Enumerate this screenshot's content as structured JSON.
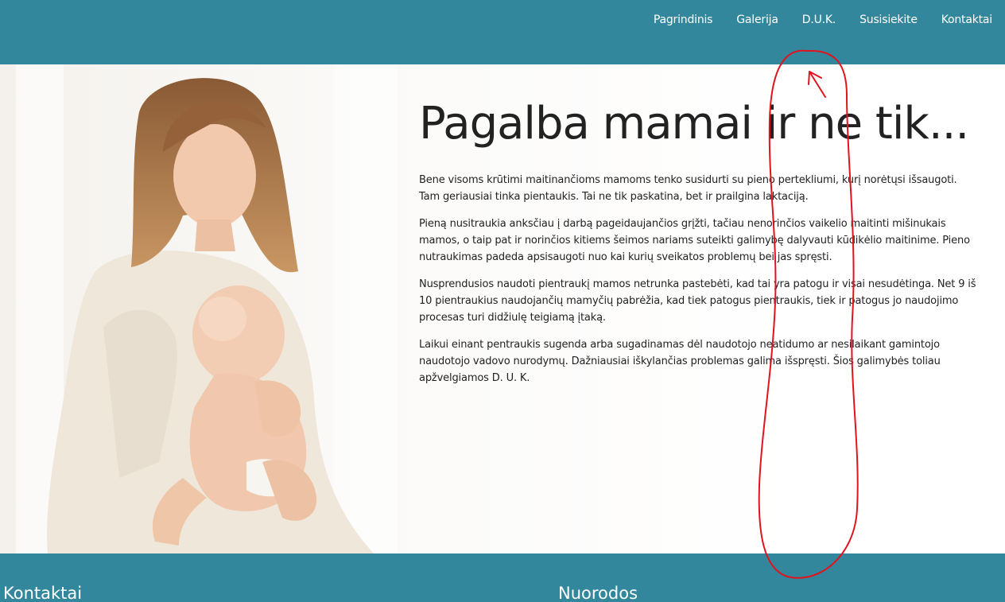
{
  "nav": {
    "items": [
      {
        "label": "Pagrindinis"
      },
      {
        "label": "Galerija"
      },
      {
        "label": "D.U.K."
      },
      {
        "label": "Susisiekite"
      },
      {
        "label": "Kontaktai"
      }
    ]
  },
  "hero": {
    "title": "Pagalba mamai ir ne tik...",
    "paragraphs": [
      "Bene visoms krūtimi maitinančioms mamoms tenko susidurti su pieno pertekliumi, kurį norėtųsi išsaugoti. Tam geriausiai tinka pientaukis. Tai ne tik paskatina, bet ir prailgina laktaciją.",
      "Pieną nusitraukia anksčiau į darbą pageidaujančios grįžti, tačiau nenorinčios vaikelio maitinti mišinukais mamos, o taip pat ir norinčios kitiems šeimos nariams suteikti galimybę dalyvauti kūdikėlio maitinime. Pieno nutraukimas padeda apsisaugoti nuo kai kurių sveikatos problemų bei jas spręsti.",
      "Nusprendusios naudoti pientraukį mamos netrunka pastebėti, kad tai yra patogu ir visai nesudėtinga. Net 9 iš 10 pientraukius naudojančių mamyčių pabrėžia, kad tiek patogus pientraukis, tiek ir patogus jo naudojimo procesas turi didžiulę teigiamą įtaką.",
      "Laikui einant pentraukis sugenda arba sugadinamas dėl naudotojo neatidumo ar nesilaikant gamintojo naudotojo vadovo nurodymų. Dažniausiai iškylančias problemas galima išspręsti. Šios galimybės toliau apžvelgiamos D. U. K."
    ]
  },
  "footer": {
    "contacts_title": "Kontaktai",
    "links_title": "Nuorodos"
  },
  "colors": {
    "brand_teal": "#33879c",
    "annotation_red": "#e0141e"
  },
  "icons": {
    "photo": "mother-with-baby-photo"
  }
}
